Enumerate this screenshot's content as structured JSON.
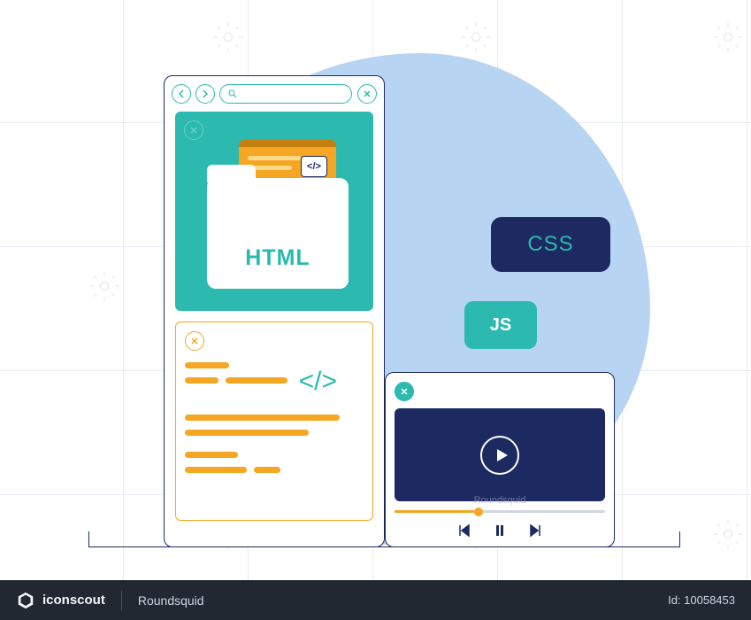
{
  "illustration": {
    "html_folder_label": "HTML",
    "css_label": "CSS",
    "js_label": "JS",
    "code_tag_symbol": "</>"
  },
  "video_watermark": "Roundsquid",
  "footer": {
    "brand": "iconscout",
    "contributor": "Roundsquid",
    "id_label": "Id: 10058453"
  }
}
